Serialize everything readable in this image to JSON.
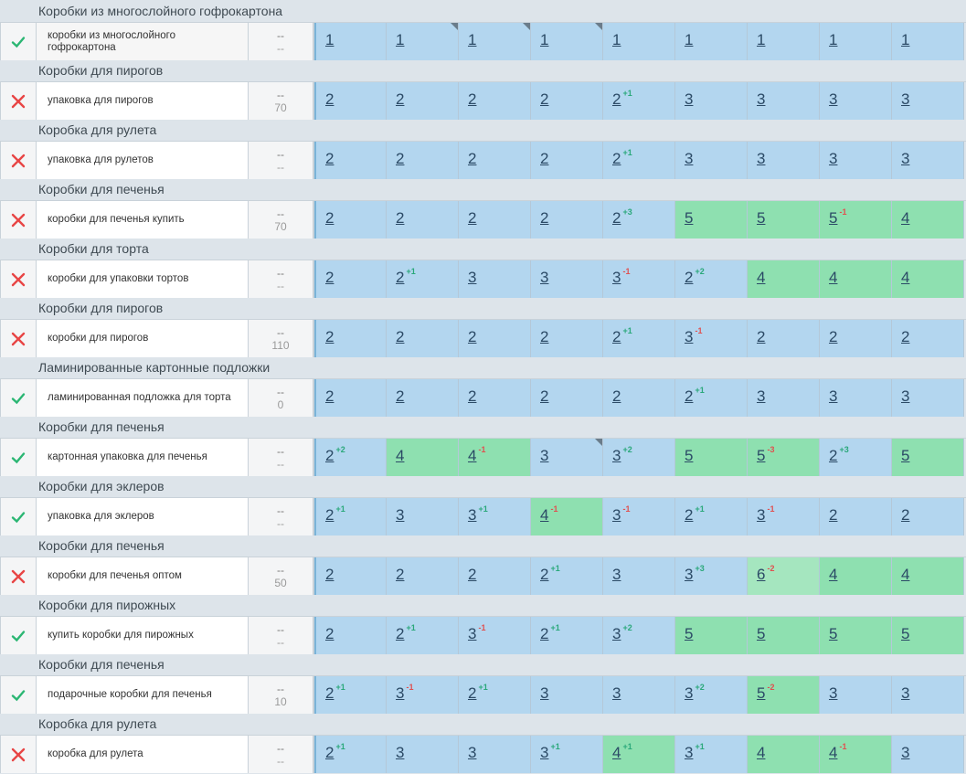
{
  "colors": {
    "ok": "#2bb673",
    "bad": "#e84545",
    "blue": "#b3d6ef",
    "green": "#8ee0b0",
    "lightgreen": "#a5e6bf"
  },
  "rows": [
    {
      "group": "Коробки из многослойного гофрокартона",
      "status": "check",
      "keyword": "коробки из многослойного гофрокартона",
      "freq_top": "--",
      "freq_bottom": "--",
      "positions": [
        {
          "v": "1",
          "d": ""
        },
        {
          "v": "1",
          "d": "",
          "corner": true
        },
        {
          "v": "1",
          "d": "",
          "corner": true
        },
        {
          "v": "1",
          "d": "",
          "corner": true
        },
        {
          "v": "1",
          "d": ""
        },
        {
          "v": "1",
          "d": ""
        },
        {
          "v": "1",
          "d": ""
        },
        {
          "v": "1",
          "d": ""
        },
        {
          "v": "1",
          "d": ""
        }
      ]
    },
    {
      "group": "Коробки для пирогов",
      "status": "cross",
      "keyword": "упаковка для пирогов",
      "freq_top": "--",
      "freq_bottom": "70",
      "positions": [
        {
          "v": "2",
          "d": ""
        },
        {
          "v": "2",
          "d": ""
        },
        {
          "v": "2",
          "d": ""
        },
        {
          "v": "2",
          "d": ""
        },
        {
          "v": "2",
          "d": "+1"
        },
        {
          "v": "3",
          "d": ""
        },
        {
          "v": "3",
          "d": ""
        },
        {
          "v": "3",
          "d": ""
        },
        {
          "v": "3",
          "d": ""
        }
      ]
    },
    {
      "group": "Коробка для рулета",
      "status": "cross",
      "keyword": "упаковка для рулетов",
      "freq_top": "--",
      "freq_bottom": "--",
      "positions": [
        {
          "v": "2",
          "d": ""
        },
        {
          "v": "2",
          "d": ""
        },
        {
          "v": "2",
          "d": ""
        },
        {
          "v": "2",
          "d": ""
        },
        {
          "v": "2",
          "d": "+1"
        },
        {
          "v": "3",
          "d": ""
        },
        {
          "v": "3",
          "d": ""
        },
        {
          "v": "3",
          "d": ""
        },
        {
          "v": "3",
          "d": ""
        }
      ]
    },
    {
      "group": "Коробки для печенья",
      "status": "cross",
      "keyword": "коробки для печенья купить",
      "freq_top": "--",
      "freq_bottom": "70",
      "positions": [
        {
          "v": "2",
          "d": ""
        },
        {
          "v": "2",
          "d": ""
        },
        {
          "v": "2",
          "d": ""
        },
        {
          "v": "2",
          "d": ""
        },
        {
          "v": "2",
          "d": "+3"
        },
        {
          "v": "5",
          "d": "",
          "c": "green"
        },
        {
          "v": "5",
          "d": "",
          "c": "green"
        },
        {
          "v": "5",
          "d": "-1",
          "c": "green"
        },
        {
          "v": "4",
          "d": "",
          "c": "green"
        }
      ]
    },
    {
      "group": "Коробки для торта",
      "status": "cross",
      "keyword": "коробки для упаковки тортов",
      "freq_top": "--",
      "freq_bottom": "--",
      "positions": [
        {
          "v": "2",
          "d": ""
        },
        {
          "v": "2",
          "d": "+1"
        },
        {
          "v": "3",
          "d": ""
        },
        {
          "v": "3",
          "d": ""
        },
        {
          "v": "3",
          "d": "-1"
        },
        {
          "v": "2",
          "d": "+2"
        },
        {
          "v": "4",
          "d": "",
          "c": "green"
        },
        {
          "v": "4",
          "d": "",
          "c": "green"
        },
        {
          "v": "4",
          "d": "",
          "c": "green"
        }
      ]
    },
    {
      "group": "Коробки для пирогов",
      "status": "cross",
      "keyword": "коробки для пирогов",
      "freq_top": "--",
      "freq_bottom": "110",
      "positions": [
        {
          "v": "2",
          "d": ""
        },
        {
          "v": "2",
          "d": ""
        },
        {
          "v": "2",
          "d": ""
        },
        {
          "v": "2",
          "d": ""
        },
        {
          "v": "2",
          "d": "+1"
        },
        {
          "v": "3",
          "d": "-1"
        },
        {
          "v": "2",
          "d": ""
        },
        {
          "v": "2",
          "d": ""
        },
        {
          "v": "2",
          "d": ""
        }
      ]
    },
    {
      "group": "Ламинированные картонные подложки",
      "status": "check",
      "keyword": "ламинированная подложка для торта",
      "freq_top": "--",
      "freq_bottom": "0",
      "positions": [
        {
          "v": "2",
          "d": ""
        },
        {
          "v": "2",
          "d": ""
        },
        {
          "v": "2",
          "d": ""
        },
        {
          "v": "2",
          "d": ""
        },
        {
          "v": "2",
          "d": ""
        },
        {
          "v": "2",
          "d": "+1"
        },
        {
          "v": "3",
          "d": ""
        },
        {
          "v": "3",
          "d": ""
        },
        {
          "v": "3",
          "d": ""
        }
      ]
    },
    {
      "group": "Коробки для печенья",
      "status": "check",
      "keyword": "картонная упаковка для печенья",
      "freq_top": "--",
      "freq_bottom": "--",
      "positions": [
        {
          "v": "2",
          "d": "+2"
        },
        {
          "v": "4",
          "d": "",
          "c": "green"
        },
        {
          "v": "4",
          "d": "-1",
          "c": "green"
        },
        {
          "v": "3",
          "d": "",
          "corner": true
        },
        {
          "v": "3",
          "d": "+2"
        },
        {
          "v": "5",
          "d": "",
          "c": "green"
        },
        {
          "v": "5",
          "d": "-3",
          "c": "green"
        },
        {
          "v": "2",
          "d": "+3"
        },
        {
          "v": "5",
          "d": "",
          "c": "green"
        }
      ]
    },
    {
      "group": "Коробки для эклеров",
      "status": "check",
      "keyword": "упаковка для эклеров",
      "freq_top": "--",
      "freq_bottom": "--",
      "positions": [
        {
          "v": "2",
          "d": "+1"
        },
        {
          "v": "3",
          "d": ""
        },
        {
          "v": "3",
          "d": "+1"
        },
        {
          "v": "4",
          "d": "-1",
          "c": "green"
        },
        {
          "v": "3",
          "d": "-1"
        },
        {
          "v": "2",
          "d": "+1"
        },
        {
          "v": "3",
          "d": "-1"
        },
        {
          "v": "2",
          "d": ""
        },
        {
          "v": "2",
          "d": ""
        }
      ]
    },
    {
      "group": "Коробки для печенья",
      "status": "cross",
      "keyword": "коробки для печенья оптом",
      "freq_top": "--",
      "freq_bottom": "50",
      "positions": [
        {
          "v": "2",
          "d": ""
        },
        {
          "v": "2",
          "d": ""
        },
        {
          "v": "2",
          "d": ""
        },
        {
          "v": "2",
          "d": "+1"
        },
        {
          "v": "3",
          "d": ""
        },
        {
          "v": "3",
          "d": "+3"
        },
        {
          "v": "6",
          "d": "-2",
          "c": "lightgreen"
        },
        {
          "v": "4",
          "d": "",
          "c": "green"
        },
        {
          "v": "4",
          "d": "",
          "c": "green"
        }
      ]
    },
    {
      "group": "Коробки для пирожных",
      "status": "check",
      "keyword": "купить коробки для пирожных",
      "freq_top": "--",
      "freq_bottom": "--",
      "positions": [
        {
          "v": "2",
          "d": ""
        },
        {
          "v": "2",
          "d": "+1"
        },
        {
          "v": "3",
          "d": "-1"
        },
        {
          "v": "2",
          "d": "+1"
        },
        {
          "v": "3",
          "d": "+2"
        },
        {
          "v": "5",
          "d": "",
          "c": "green"
        },
        {
          "v": "5",
          "d": "",
          "c": "green"
        },
        {
          "v": "5",
          "d": "",
          "c": "green"
        },
        {
          "v": "5",
          "d": "",
          "c": "green"
        }
      ]
    },
    {
      "group": "Коробки для печенья",
      "status": "check",
      "keyword": "подарочные коробки для печенья",
      "freq_top": "--",
      "freq_bottom": "10",
      "positions": [
        {
          "v": "2",
          "d": "+1"
        },
        {
          "v": "3",
          "d": "-1"
        },
        {
          "v": "2",
          "d": "+1"
        },
        {
          "v": "3",
          "d": ""
        },
        {
          "v": "3",
          "d": ""
        },
        {
          "v": "3",
          "d": "+2"
        },
        {
          "v": "5",
          "d": "-2",
          "c": "green"
        },
        {
          "v": "3",
          "d": ""
        },
        {
          "v": "3",
          "d": ""
        }
      ]
    },
    {
      "group": "Коробка для рулета",
      "status": "cross",
      "keyword": "коробка для рулета",
      "freq_top": "--",
      "freq_bottom": "--",
      "positions": [
        {
          "v": "2",
          "d": "+1"
        },
        {
          "v": "3",
          "d": ""
        },
        {
          "v": "3",
          "d": ""
        },
        {
          "v": "3",
          "d": "+1"
        },
        {
          "v": "4",
          "d": "+1",
          "c": "green"
        },
        {
          "v": "3",
          "d": "+1"
        },
        {
          "v": "4",
          "d": "",
          "c": "green"
        },
        {
          "v": "4",
          "d": "-1",
          "c": "green"
        },
        {
          "v": "3",
          "d": ""
        }
      ]
    }
  ]
}
